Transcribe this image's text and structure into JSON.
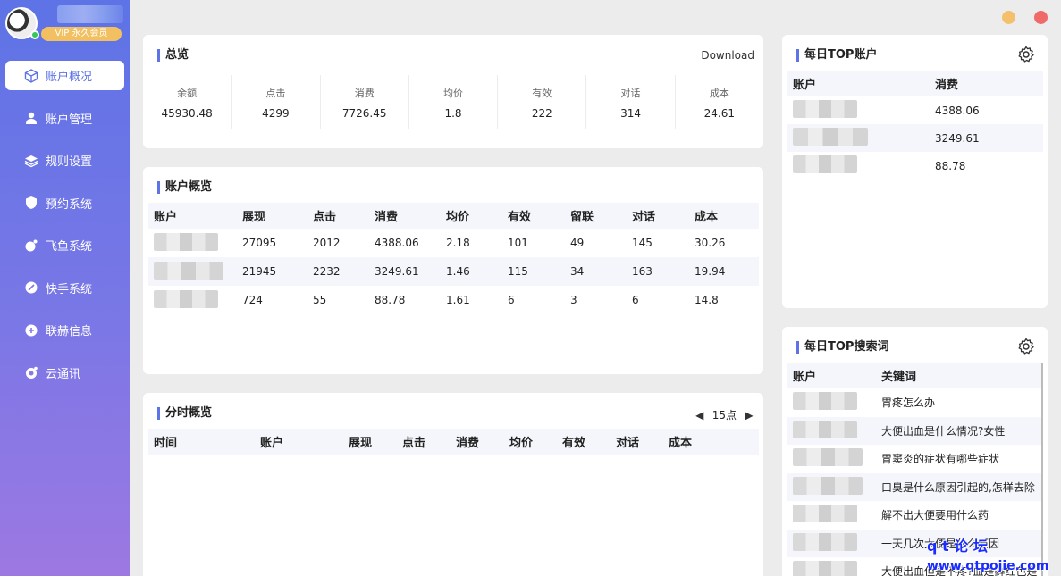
{
  "sidebar": {
    "vip": "VIP 永久会员",
    "items": [
      {
        "label": "账户概况",
        "icon": "cube-icon",
        "active": true
      },
      {
        "label": "账户管理",
        "icon": "user-icon",
        "active": false
      },
      {
        "label": "规则设置",
        "icon": "layers-icon",
        "active": false
      },
      {
        "label": "预约系统",
        "icon": "shield-icon",
        "active": false
      },
      {
        "label": "飞鱼系统",
        "icon": "fish-icon",
        "active": false
      },
      {
        "label": "快手系统",
        "icon": "rocket-icon",
        "active": false
      },
      {
        "label": "联赫信息",
        "icon": "link-icon",
        "active": false
      },
      {
        "label": "云通讯",
        "icon": "cloud-icon",
        "active": false
      }
    ]
  },
  "summary": {
    "title": "总览",
    "download": "Download",
    "stats": [
      {
        "label": "余额",
        "value": "45930.48"
      },
      {
        "label": "点击",
        "value": "4299"
      },
      {
        "label": "消费",
        "value": "7726.45"
      },
      {
        "label": "均价",
        "value": "1.8"
      },
      {
        "label": "有效",
        "value": "222"
      },
      {
        "label": "对话",
        "value": "314"
      },
      {
        "label": "成本",
        "value": "24.61"
      }
    ]
  },
  "account_overview": {
    "title": "账户概览",
    "columns": [
      "账户",
      "展现",
      "点击",
      "消费",
      "均价",
      "有效",
      "留联",
      "对话",
      "成本"
    ],
    "rows": [
      [
        "",
        "27095",
        "2012",
        "4388.06",
        "2.18",
        "101",
        "49",
        "145",
        "30.26"
      ],
      [
        "",
        "21945",
        "2232",
        "3249.61",
        "1.46",
        "115",
        "34",
        "163",
        "19.94"
      ],
      [
        "",
        "724",
        "55",
        "88.78",
        "1.61",
        "6",
        "3",
        "6",
        "14.8"
      ]
    ]
  },
  "time_overview": {
    "title": "分时概览",
    "period": "15点",
    "columns": [
      "时间",
      "账户",
      "展现",
      "点击",
      "消费",
      "均价",
      "有效",
      "对话",
      "成本"
    ]
  },
  "top_accounts": {
    "title": "每日TOP账户",
    "columns": [
      "账户",
      "消费"
    ],
    "rows": [
      [
        "",
        "4388.06"
      ],
      [
        "",
        "3249.61"
      ],
      [
        "",
        "88.78"
      ]
    ]
  },
  "top_keywords": {
    "title": "每日TOP搜索词",
    "columns": [
      "账户",
      "关键词"
    ],
    "rows": [
      [
        "",
        "胃疼怎么办"
      ],
      [
        "",
        "大便出血是什么情况?女性"
      ],
      [
        "",
        "胃窦炎的症状有哪些症状"
      ],
      [
        "",
        "口臭是什么原因引起的,怎样去除"
      ],
      [
        "",
        "解不出大便要用什么药"
      ],
      [
        "",
        "一天几次大便是什么原因"
      ],
      [
        "",
        "大便出血但是不疼?血是鲜红色是"
      ]
    ]
  },
  "watermark": {
    "line1": "q  t 论 坛",
    "line2": "www.qtpojie.com"
  },
  "colors": {
    "accent": "#5d73e6",
    "vip": "#f2c061",
    "min": "#f5c06b",
    "close": "#f06a6a"
  }
}
